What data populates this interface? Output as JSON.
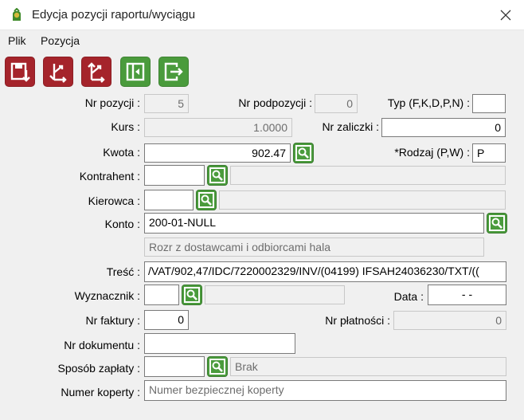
{
  "window": {
    "title": "Edycja pozycji raportu/wyciągu"
  },
  "menu": {
    "file": "Plik",
    "position": "Pozycja"
  },
  "colors": {
    "toolbar_red": "#a5242b",
    "toolbar_green": "#4a9b3c"
  },
  "toolbar": {
    "icons": [
      "save-icon",
      "branch-down-icon",
      "branch-up-icon",
      "first-icon",
      "exit-icon"
    ]
  },
  "form": {
    "nr_pozycji": {
      "label": "Nr pozycji :",
      "value": "5"
    },
    "nr_podpozycji": {
      "label": "Nr podpozycji :",
      "value": "0"
    },
    "typ": {
      "label": "Typ (F,K,D,P,N) :",
      "value": ""
    },
    "kurs": {
      "label": "Kurs :",
      "value": "1.0000"
    },
    "nr_zaliczki": {
      "label": "Nr zaliczki :",
      "value": "0"
    },
    "kwota": {
      "label": "Kwota :",
      "value": "902.47"
    },
    "rodzaj": {
      "label": "*Rodzaj (P,W) :",
      "value": "P"
    },
    "kontrahent": {
      "label": "Kontrahent :",
      "value": "",
      "description": ""
    },
    "kierowca": {
      "label": "Kierowca :",
      "value": "",
      "description": ""
    },
    "konto": {
      "label": "Konto :",
      "value": "200-01-NULL",
      "description": "Rozr z dostawcami i odbiorcami hala"
    },
    "tresc": {
      "label": "Treść :",
      "value": "/VAT/902,47/IDC/7220002329/INV/(04199) IFSAH24036230/TXT/(("
    },
    "wyznacznik": {
      "label": "Wyznacznik :",
      "value": "",
      "description": ""
    },
    "data": {
      "label": "Data :",
      "value": "- -"
    },
    "nr_faktury": {
      "label": "Nr faktury :",
      "value": "0"
    },
    "nr_platnosci": {
      "label": "Nr płatności :",
      "value": "0"
    },
    "nr_dokumentu": {
      "label": "Nr dokumentu :",
      "value": ""
    },
    "sposob_zaplaty": {
      "label": "Sposób zapłaty :",
      "value": "",
      "description": "Brak"
    },
    "numer_koperty": {
      "label": "Numer koperty :",
      "placeholder": "Numer bezpiecznej koperty"
    }
  }
}
